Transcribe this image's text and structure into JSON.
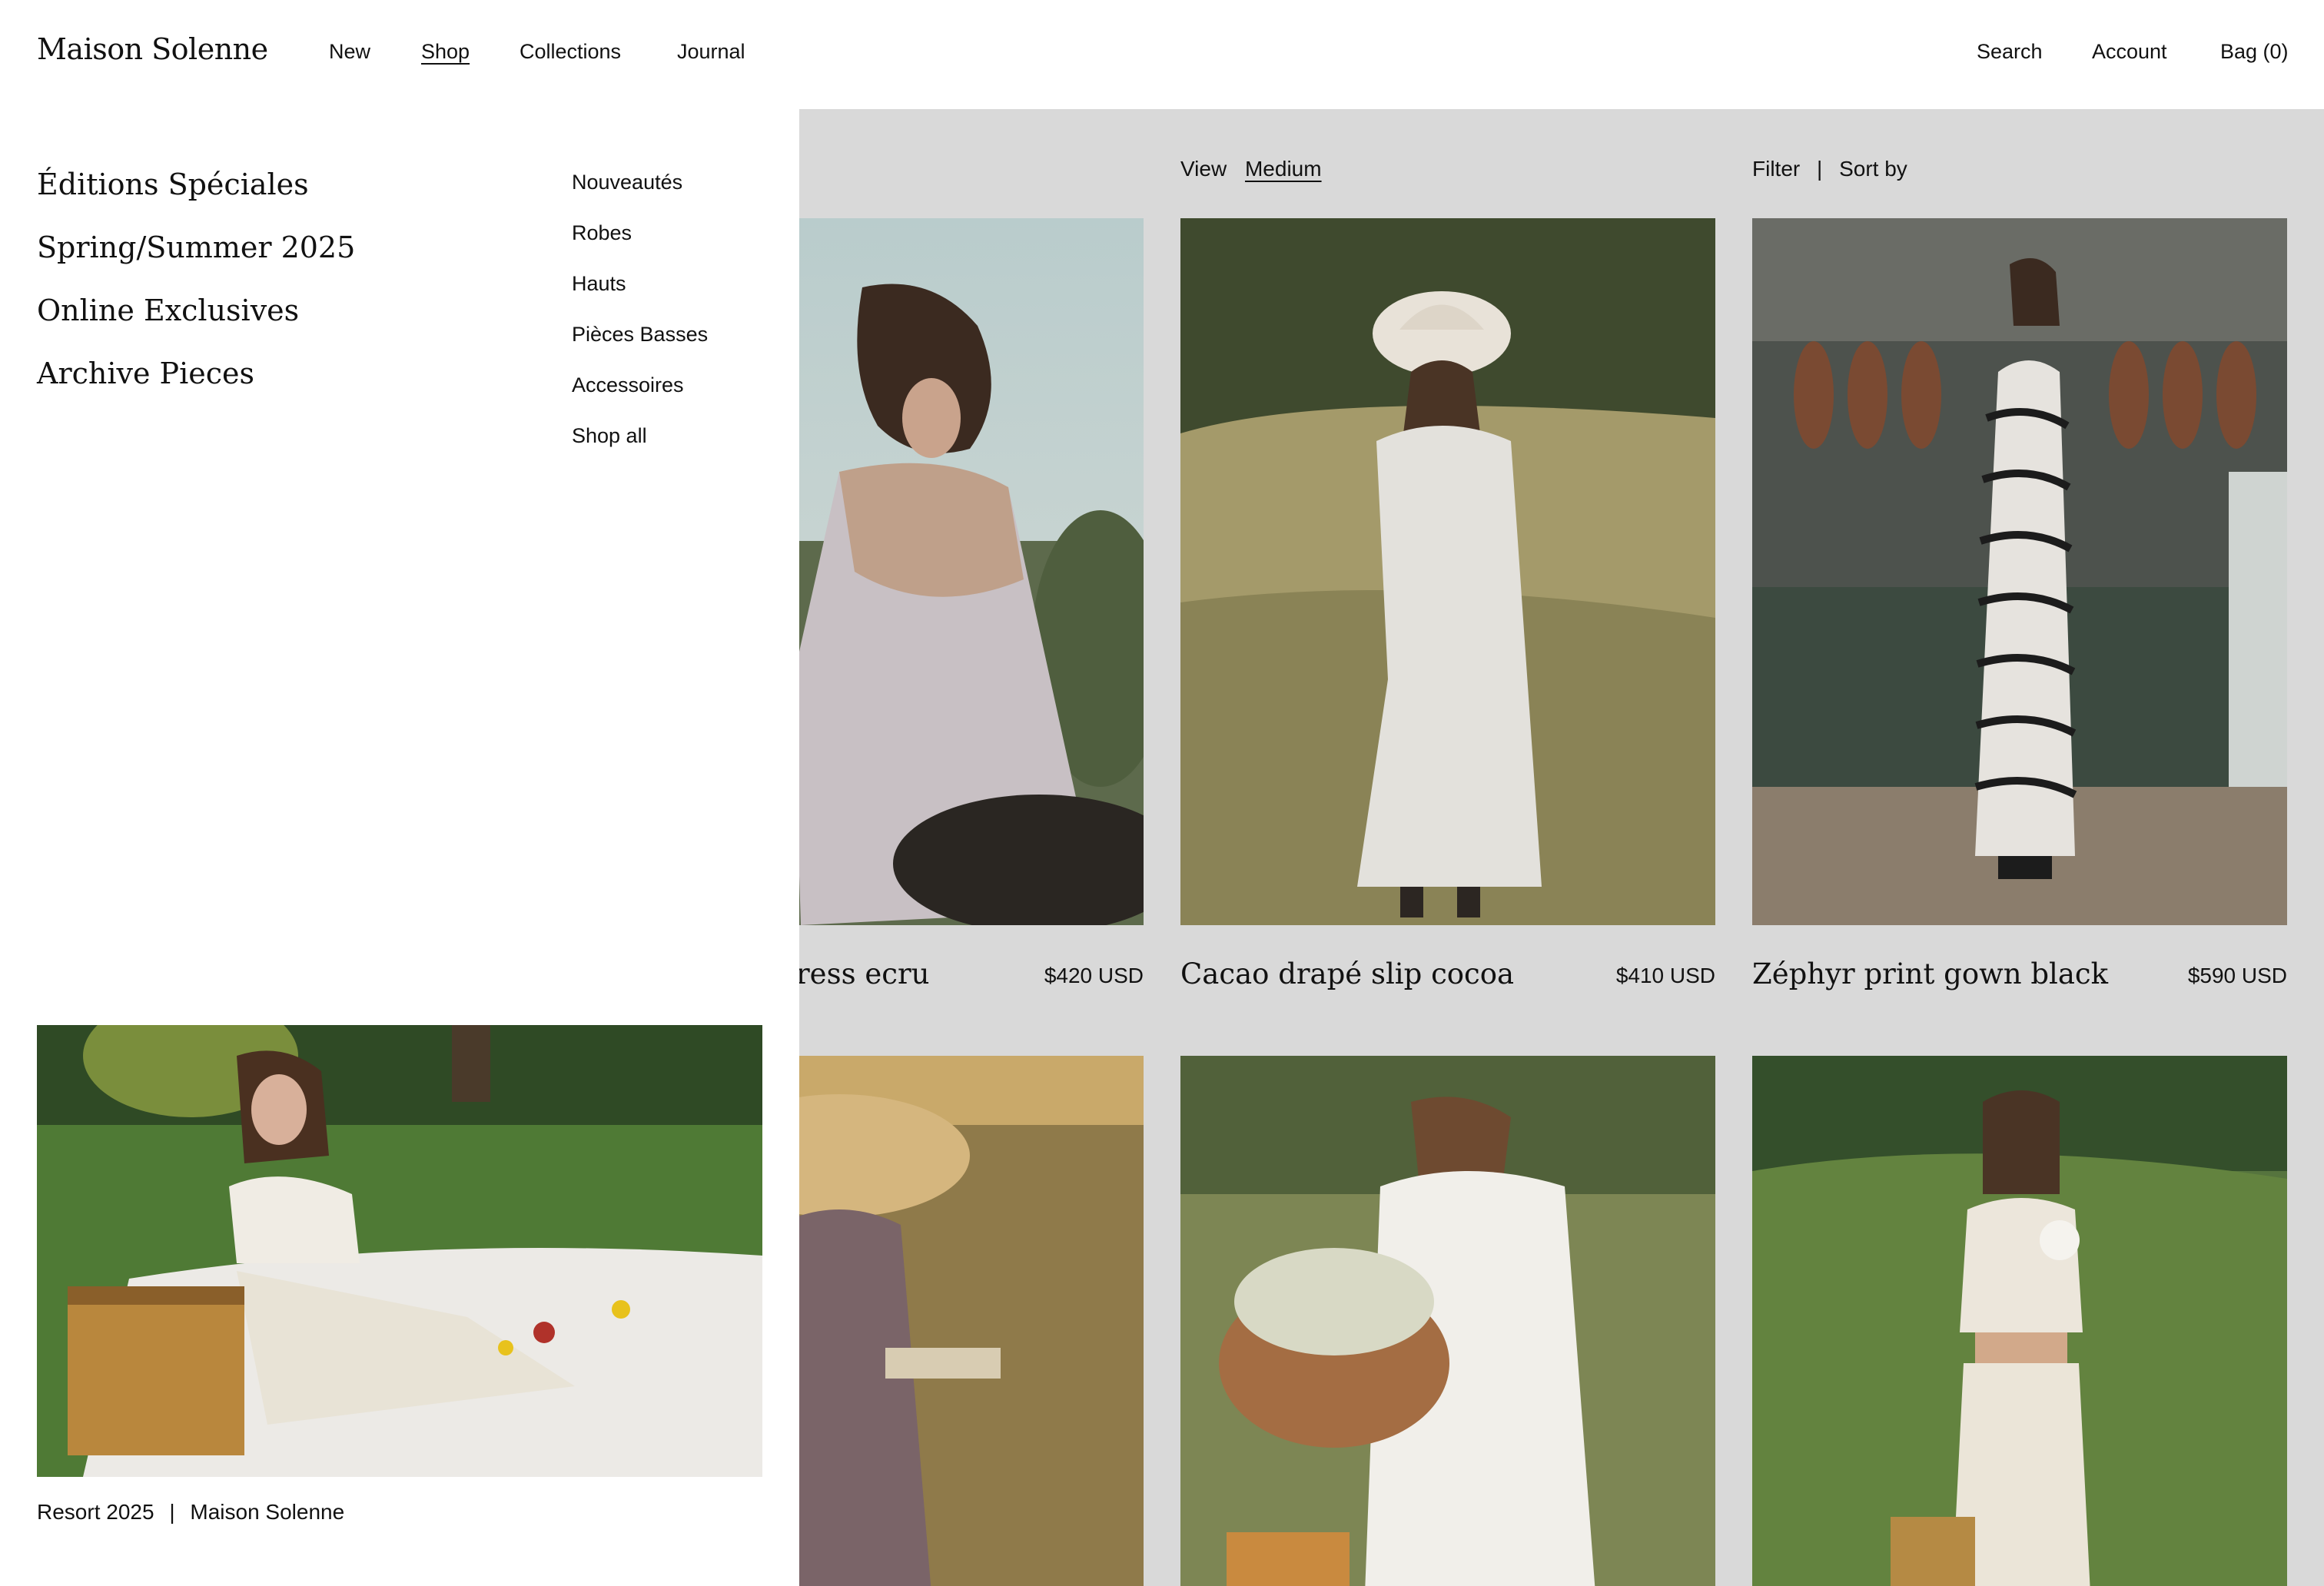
{
  "brand": {
    "name": "Maison Solenne"
  },
  "nav": {
    "new": "New",
    "shop": "Shop",
    "collections": "Collections",
    "journal": "Journal"
  },
  "utility": {
    "search": "Search",
    "account": "Account",
    "bag": "Bag (0)"
  },
  "toolbar": {
    "view_label": "View",
    "view_value": "Medium",
    "filter": "Filter",
    "separator": "|",
    "sort": "Sort by"
  },
  "menu": {
    "featured": [
      "Éditions Spéciales",
      "Spring/Summer 2025",
      "Online Exclusives",
      "Archive Pieces"
    ],
    "categories": [
      "Nouveautés",
      "Robes",
      "Hauts",
      "Pièces Basses",
      "Accessoires",
      "Shop all"
    ],
    "promo_caption": {
      "title": "Resort 2025",
      "separator": "|",
      "brand": "Maison Solenne"
    }
  },
  "products": [
    {
      "name": "ress ecru",
      "price": "$420 USD"
    },
    {
      "name": "Cacao drapé slip cocoa",
      "price": "$410 USD"
    },
    {
      "name": "Zéphyr print gown black",
      "price": "$590 USD"
    }
  ]
}
